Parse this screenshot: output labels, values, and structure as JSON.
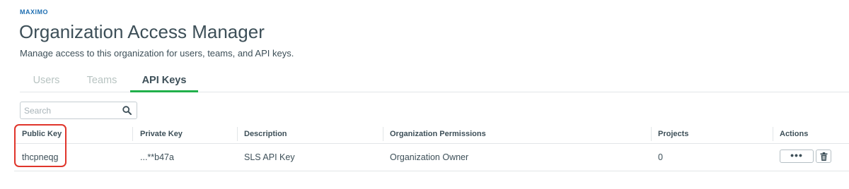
{
  "header": {
    "brand": "MAXIMO",
    "title": "Organization Access Manager",
    "subtitle": "Manage access to this organization for users, teams, and API keys."
  },
  "tabs": [
    {
      "label": "Users",
      "active": false
    },
    {
      "label": "Teams",
      "active": false
    },
    {
      "label": "API Keys",
      "active": true
    }
  ],
  "search": {
    "placeholder": "Search",
    "value": "",
    "icon": "search-icon"
  },
  "table": {
    "columns": [
      "Public Key",
      "Private Key",
      "Description",
      "Organization Permissions",
      "Projects",
      "Actions"
    ],
    "rows": [
      {
        "public_key": "thcpneqg",
        "private_key": "...**b47a",
        "description": "SLS API Key",
        "permissions": "Organization Owner",
        "projects": "0",
        "actions": {
          "more": "•••",
          "delete_icon": "trash-icon"
        }
      }
    ]
  },
  "colors": {
    "accent_green": "#21b04b",
    "brand_blue": "#1f6fb2",
    "highlight_red": "#e0352b",
    "text": "#3d4f58"
  }
}
